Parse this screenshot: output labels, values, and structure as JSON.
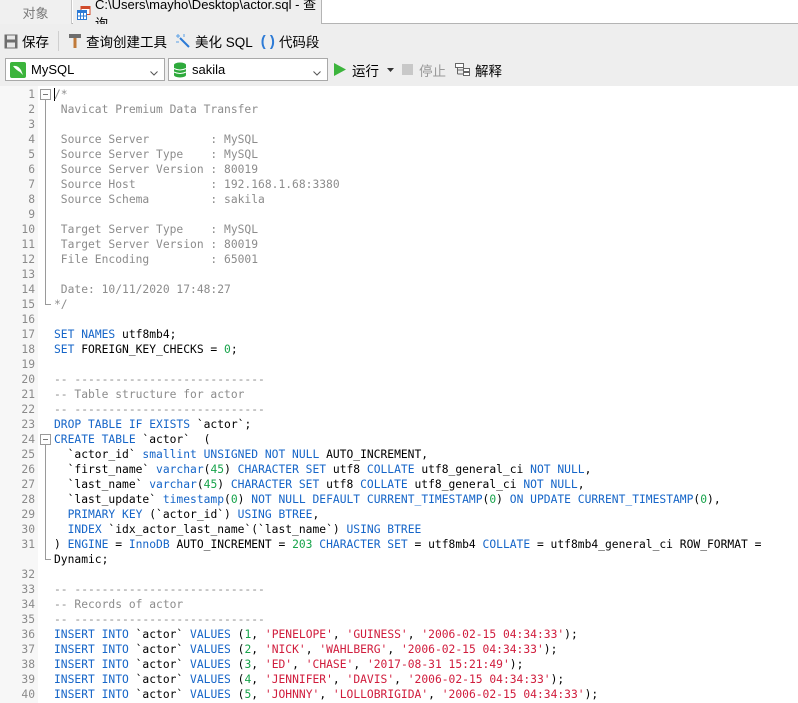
{
  "tabs": [
    {
      "label": "对象",
      "active": false
    },
    {
      "label": "C:\\Users\\mayho\\Desktop\\actor.sql - 查询",
      "active": true,
      "icon": "query-table-icon"
    }
  ],
  "toolbar": {
    "save_label": "保存",
    "query_builder_label": "查询创建工具",
    "beautify_label": "美化 SQL",
    "snippet_label": "代码段",
    "connection": "MySQL",
    "database": "sakila",
    "run_label": "运行",
    "stop_label": "停止",
    "explain_label": "解释"
  },
  "colors": {
    "keyword": "#1565c8",
    "comment": "#8c8c8c",
    "number": "#16a34a",
    "string": "#d01c3c",
    "run_green": "#3cb43c",
    "db_green": "#2eaa3c"
  },
  "editor": {
    "lines": [
      {
        "n": "1",
        "fold": "start",
        "caret": true,
        "tokens": [
          [
            "cm",
            "/*"
          ]
        ]
      },
      {
        "n": "2",
        "tokens": [
          [
            "cm",
            " Navicat Premium Data Transfer"
          ]
        ]
      },
      {
        "n": "3",
        "tokens": []
      },
      {
        "n": "4",
        "tokens": [
          [
            "cm",
            " Source Server         : MySQL"
          ]
        ]
      },
      {
        "n": "5",
        "tokens": [
          [
            "cm",
            " Source Server Type    : MySQL"
          ]
        ]
      },
      {
        "n": "6",
        "tokens": [
          [
            "cm",
            " Source Server Version : 80019"
          ]
        ]
      },
      {
        "n": "7",
        "tokens": [
          [
            "cm",
            " Source Host           : 192.168.1.68:3380"
          ]
        ]
      },
      {
        "n": "8",
        "tokens": [
          [
            "cm",
            " Source Schema         : sakila"
          ]
        ]
      },
      {
        "n": "9",
        "tokens": []
      },
      {
        "n": "10",
        "tokens": [
          [
            "cm",
            " Target Server Type    : MySQL"
          ]
        ]
      },
      {
        "n": "11",
        "tokens": [
          [
            "cm",
            " Target Server Version : 80019"
          ]
        ]
      },
      {
        "n": "12",
        "tokens": [
          [
            "cm",
            " File Encoding         : 65001"
          ]
        ]
      },
      {
        "n": "13",
        "tokens": []
      },
      {
        "n": "14",
        "tokens": [
          [
            "cm",
            " Date: 10/11/2020 17:48:27"
          ]
        ]
      },
      {
        "n": "15",
        "fold": "end",
        "tokens": [
          [
            "cm",
            "*/"
          ]
        ]
      },
      {
        "n": "16",
        "tokens": []
      },
      {
        "n": "17",
        "tokens": [
          [
            "kw",
            "SET"
          ],
          [
            "tx",
            " "
          ],
          [
            "kw",
            "NAMES"
          ],
          [
            "tx",
            " utf8mb4;"
          ]
        ]
      },
      {
        "n": "18",
        "tokens": [
          [
            "kw",
            "SET"
          ],
          [
            "tx",
            " FOREIGN_KEY_CHECKS = "
          ],
          [
            "num",
            "0"
          ],
          [
            "tx",
            ";"
          ]
        ]
      },
      {
        "n": "19",
        "tokens": []
      },
      {
        "n": "20",
        "tokens": [
          [
            "cm",
            "-- ----------------------------"
          ]
        ]
      },
      {
        "n": "21",
        "tokens": [
          [
            "cm",
            "-- Table structure for actor"
          ]
        ]
      },
      {
        "n": "22",
        "tokens": [
          [
            "cm",
            "-- ----------------------------"
          ]
        ]
      },
      {
        "n": "23",
        "tokens": [
          [
            "kw",
            "DROP TABLE IF EXISTS"
          ],
          [
            "tx",
            " `actor`;"
          ]
        ]
      },
      {
        "n": "24",
        "fold": "start",
        "tokens": [
          [
            "kw",
            "CREATE TABLE"
          ],
          [
            "tx",
            " `actor`  ("
          ]
        ]
      },
      {
        "n": "25",
        "tokens": [
          [
            "tx",
            "  `actor_id` "
          ],
          [
            "kw",
            "smallint UNSIGNED NOT NULL"
          ],
          [
            "tx",
            " AUTO_INCREMENT,"
          ]
        ]
      },
      {
        "n": "26",
        "tokens": [
          [
            "tx",
            "  `first_name` "
          ],
          [
            "kw",
            "varchar"
          ],
          [
            "tx",
            "("
          ],
          [
            "num",
            "45"
          ],
          [
            "tx",
            ") "
          ],
          [
            "kw",
            "CHARACTER SET"
          ],
          [
            "tx",
            " utf8 "
          ],
          [
            "kw",
            "COLLATE"
          ],
          [
            "tx",
            " utf8_general_ci "
          ],
          [
            "kw",
            "NOT NULL"
          ],
          [
            "tx",
            ","
          ]
        ]
      },
      {
        "n": "27",
        "tokens": [
          [
            "tx",
            "  `last_name` "
          ],
          [
            "kw",
            "varchar"
          ],
          [
            "tx",
            "("
          ],
          [
            "num",
            "45"
          ],
          [
            "tx",
            ") "
          ],
          [
            "kw",
            "CHARACTER SET"
          ],
          [
            "tx",
            " utf8 "
          ],
          [
            "kw",
            "COLLATE"
          ],
          [
            "tx",
            " utf8_general_ci "
          ],
          [
            "kw",
            "NOT NULL"
          ],
          [
            "tx",
            ","
          ]
        ]
      },
      {
        "n": "28",
        "tokens": [
          [
            "tx",
            "  `last_update` "
          ],
          [
            "kw",
            "timestamp"
          ],
          [
            "tx",
            "("
          ],
          [
            "num",
            "0"
          ],
          [
            "tx",
            ") "
          ],
          [
            "kw",
            "NOT NULL DEFAULT CURRENT_TIMESTAMP"
          ],
          [
            "tx",
            "("
          ],
          [
            "num",
            "0"
          ],
          [
            "tx",
            ") "
          ],
          [
            "kw",
            "ON UPDATE CURRENT_TIMESTAMP"
          ],
          [
            "tx",
            "("
          ],
          [
            "num",
            "0"
          ],
          [
            "tx",
            "),"
          ]
        ]
      },
      {
        "n": "29",
        "tokens": [
          [
            "tx",
            "  "
          ],
          [
            "kw",
            "PRIMARY KEY"
          ],
          [
            "tx",
            " (`actor_id`) "
          ],
          [
            "kw",
            "USING BTREE"
          ],
          [
            "tx",
            ","
          ]
        ]
      },
      {
        "n": "30",
        "tokens": [
          [
            "tx",
            "  "
          ],
          [
            "kw",
            "INDEX"
          ],
          [
            "tx",
            " `idx_actor_last_name`(`last_name`) "
          ],
          [
            "kw",
            "USING BTREE"
          ]
        ]
      },
      {
        "n": "31",
        "tokens": [
          [
            "tx",
            ") "
          ],
          [
            "kw",
            "ENGINE"
          ],
          [
            "tx",
            " = "
          ],
          [
            "kw",
            "InnoDB"
          ],
          [
            "tx",
            " AUTO_INCREMENT = "
          ],
          [
            "num",
            "203"
          ],
          [
            "tx",
            " "
          ],
          [
            "kw",
            "CHARACTER SET"
          ],
          [
            "tx",
            " = utf8mb4 "
          ],
          [
            "kw",
            "COLLATE"
          ],
          [
            "tx",
            " = utf8mb4_general_ci ROW_FORMAT ="
          ]
        ]
      },
      {
        "n": "",
        "fold": "end",
        "tokens": [
          [
            "tx",
            "Dynamic;"
          ]
        ]
      },
      {
        "n": "32",
        "tokens": []
      },
      {
        "n": "33",
        "tokens": [
          [
            "cm",
            "-- ----------------------------"
          ]
        ]
      },
      {
        "n": "34",
        "tokens": [
          [
            "cm",
            "-- Records of actor"
          ]
        ]
      },
      {
        "n": "35",
        "tokens": [
          [
            "cm",
            "-- ----------------------------"
          ]
        ]
      },
      {
        "n": "36",
        "tokens": [
          [
            "kw",
            "INSERT INTO"
          ],
          [
            "tx",
            " `actor` "
          ],
          [
            "kw",
            "VALUES"
          ],
          [
            "tx",
            " ("
          ],
          [
            "num",
            "1"
          ],
          [
            "tx",
            ", "
          ],
          [
            "str",
            "'PENELOPE'"
          ],
          [
            "tx",
            ", "
          ],
          [
            "str",
            "'GUINESS'"
          ],
          [
            "tx",
            ", "
          ],
          [
            "str",
            "'2006-02-15 04:34:33'"
          ],
          [
            "tx",
            ");"
          ]
        ]
      },
      {
        "n": "37",
        "tokens": [
          [
            "kw",
            "INSERT INTO"
          ],
          [
            "tx",
            " `actor` "
          ],
          [
            "kw",
            "VALUES"
          ],
          [
            "tx",
            " ("
          ],
          [
            "num",
            "2"
          ],
          [
            "tx",
            ", "
          ],
          [
            "str",
            "'NICK'"
          ],
          [
            "tx",
            ", "
          ],
          [
            "str",
            "'WAHLBERG'"
          ],
          [
            "tx",
            ", "
          ],
          [
            "str",
            "'2006-02-15 04:34:33'"
          ],
          [
            "tx",
            ");"
          ]
        ]
      },
      {
        "n": "38",
        "tokens": [
          [
            "kw",
            "INSERT INTO"
          ],
          [
            "tx",
            " `actor` "
          ],
          [
            "kw",
            "VALUES"
          ],
          [
            "tx",
            " ("
          ],
          [
            "num",
            "3"
          ],
          [
            "tx",
            ", "
          ],
          [
            "str",
            "'ED'"
          ],
          [
            "tx",
            ", "
          ],
          [
            "str",
            "'CHASE'"
          ],
          [
            "tx",
            ", "
          ],
          [
            "str",
            "'2017-08-31 15:21:49'"
          ],
          [
            "tx",
            ");"
          ]
        ]
      },
      {
        "n": "39",
        "tokens": [
          [
            "kw",
            "INSERT INTO"
          ],
          [
            "tx",
            " `actor` "
          ],
          [
            "kw",
            "VALUES"
          ],
          [
            "tx",
            " ("
          ],
          [
            "num",
            "4"
          ],
          [
            "tx",
            ", "
          ],
          [
            "str",
            "'JENNIFER'"
          ],
          [
            "tx",
            ", "
          ],
          [
            "str",
            "'DAVIS'"
          ],
          [
            "tx",
            ", "
          ],
          [
            "str",
            "'2006-02-15 04:34:33'"
          ],
          [
            "tx",
            ");"
          ]
        ]
      },
      {
        "n": "40",
        "tokens": [
          [
            "kw",
            "INSERT INTO"
          ],
          [
            "tx",
            " `actor` "
          ],
          [
            "kw",
            "VALUES"
          ],
          [
            "tx",
            " ("
          ],
          [
            "num",
            "5"
          ],
          [
            "tx",
            ", "
          ],
          [
            "str",
            "'JOHNNY'"
          ],
          [
            "tx",
            ", "
          ],
          [
            "str",
            "'LOLLOBRIGIDA'"
          ],
          [
            "tx",
            ", "
          ],
          [
            "str",
            "'2006-02-15 04:34:33'"
          ],
          [
            "tx",
            ");"
          ]
        ]
      }
    ]
  }
}
